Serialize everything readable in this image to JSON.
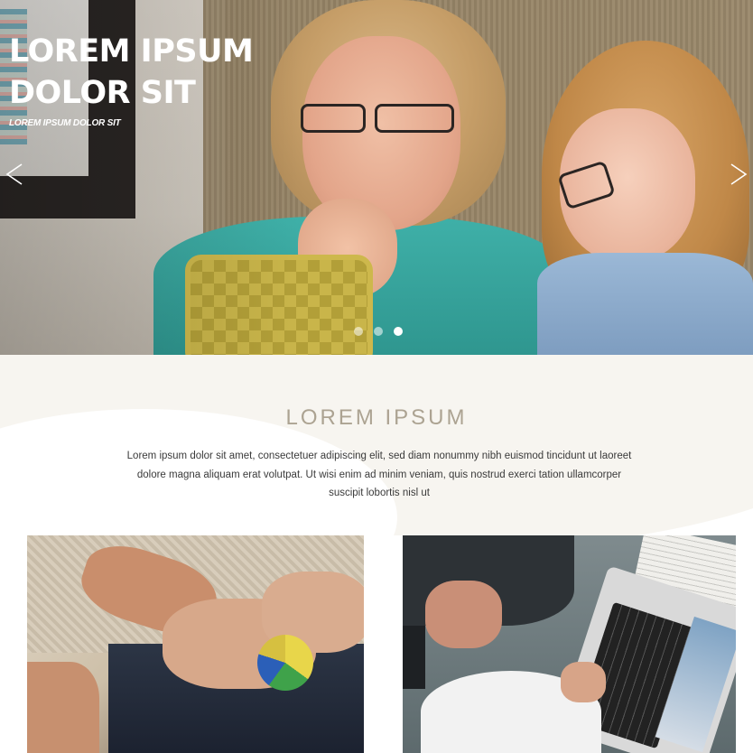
{
  "hero": {
    "title": "LOREM IPSUM DOLOR SIT",
    "subtitle": "LOREM IPSUM  DOLOR SIT",
    "prev_icon": "chevron-left-icon",
    "next_icon": "chevron-right-icon",
    "slides_total": 3,
    "active_slide": 3
  },
  "intro": {
    "title": "LOREM IPSUM",
    "body": "Lorem ipsum dolor sit amet, consectetuer adipiscing elit, sed diam nonummy nibh euismod tincidunt ut laoreet dolore magna aliquam erat volutpat. Ut wisi enim ad minim veniam, quis nostrud exerci tation ullamcorper suscipit lobortis nisl ut"
  },
  "colors": {
    "accent_title": "#aca392",
    "body_text": "#3a3a3a",
    "hero_text": "#ffffff",
    "section_bg": "#f7f5f0"
  }
}
